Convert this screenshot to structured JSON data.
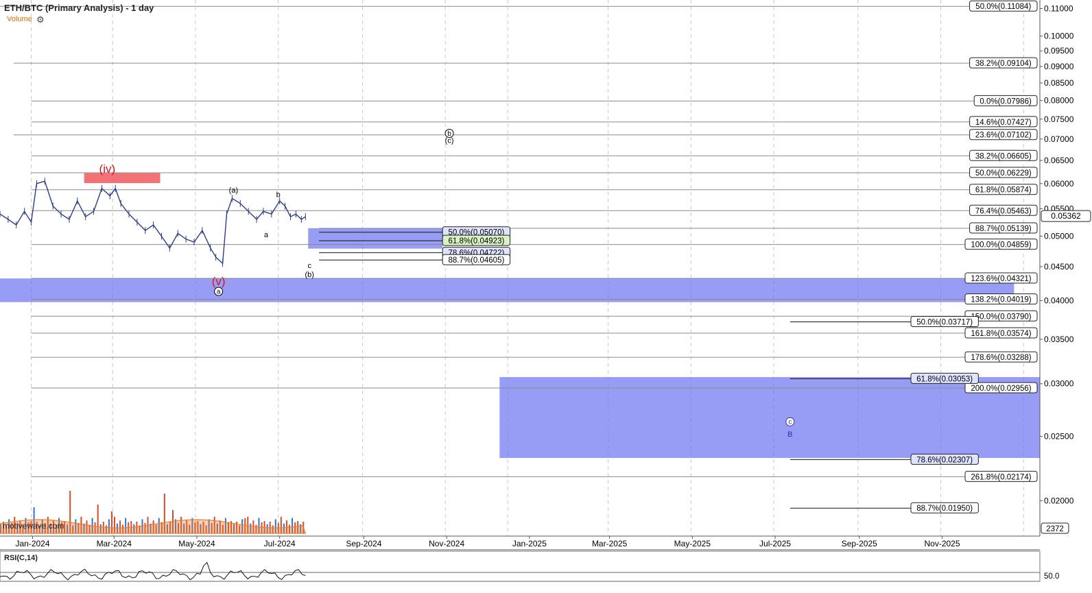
{
  "header": {
    "title": "ETH/BTC (Primary Analysis) - 1 day",
    "volume_label": "Volume",
    "settings_icon": "gear-icon"
  },
  "watermark": "motivewave.com",
  "rsi": {
    "label": "RSI(C,14)",
    "level_label": "50.0"
  },
  "colors": {
    "zone_blue": "#6b73f0",
    "zone_red": "#f0595d",
    "wave_red": "#d8141b",
    "volume_orange": "#f07c2c"
  },
  "chart_data": {
    "type": "line",
    "price_axis": {
      "scale": "log",
      "ylim": [
        0.0177,
        0.1133
      ],
      "ticks": [
        0.11,
        0.1,
        0.095,
        0.09,
        0.085,
        0.08,
        0.075,
        0.07,
        0.065,
        0.06,
        0.055,
        0.05,
        0.045,
        0.04,
        0.035,
        0.03,
        0.025,
        0.02
      ],
      "tick_labels": [
        "0.11000",
        "0.10000",
        "0.09500",
        "0.09000",
        "0.08500",
        "0.08000",
        "0.07500",
        "0.07000",
        "0.06500",
        "0.06000",
        "0.05500",
        "0.05000",
        "0.04500",
        "0.04000",
        "0.03500",
        "0.03000",
        "0.02500",
        "0.02000"
      ],
      "current_price_label": "0.05362",
      "current_price": 0.05362,
      "volume_label": "2372"
    },
    "time_axis": {
      "labels": [
        "Jan-2024",
        "Mar-2024",
        "May-2024",
        "Jul-2024",
        "Sep-2024",
        "Nov-2024",
        "Jan-2025",
        "Mar-2025",
        "May-2025",
        "Jul-2025",
        "Sep-2025",
        "Nov-2025"
      ],
      "label_dates": [
        "2024-01-01",
        "2024-03-01",
        "2024-05-01",
        "2024-07-01",
        "2024-09-01",
        "2024-11-01",
        "2025-01-01",
        "2025-03-01",
        "2025-05-01",
        "2025-07-01",
        "2025-09-01",
        "2025-11-01"
      ],
      "grid_dates": [
        "2023-12-31",
        "2024-02-29",
        "2024-04-30",
        "2024-06-30",
        "2024-08-31",
        "2024-10-31",
        "2024-12-16",
        "2025-02-28",
        "2025-04-30",
        "2025-06-30",
        "2025-08-31",
        "2025-10-31",
        "2025-12-31"
      ],
      "xlim": [
        "2023-12-08",
        "2026-01-12"
      ]
    },
    "price_series": {
      "x": [
        "2023-12-08",
        "2023-12-14",
        "2023-12-20",
        "2023-12-26",
        "2023-12-31",
        "2024-01-04",
        "2024-01-10",
        "2024-01-16",
        "2024-01-22",
        "2024-01-28",
        "2024-02-03",
        "2024-02-09",
        "2024-02-15",
        "2024-02-21",
        "2024-02-27",
        "2024-03-02",
        "2024-03-06",
        "2024-03-12",
        "2024-03-18",
        "2024-03-24",
        "2024-03-30",
        "2024-04-05",
        "2024-04-11",
        "2024-04-17",
        "2024-04-23",
        "2024-04-29",
        "2024-05-05",
        "2024-05-11",
        "2024-05-15",
        "2024-05-20",
        "2024-05-23",
        "2024-05-27",
        "2024-06-02",
        "2024-06-08",
        "2024-06-14",
        "2024-06-19",
        "2024-06-25",
        "2024-07-01",
        "2024-07-05",
        "2024-07-09",
        "2024-07-13",
        "2024-07-17",
        "2024-07-20"
      ],
      "y": [
        0.054,
        0.053,
        0.052,
        0.0545,
        0.0525,
        0.06,
        0.0605,
        0.0555,
        0.054,
        0.053,
        0.0565,
        0.0535,
        0.0545,
        0.059,
        0.0575,
        0.059,
        0.056,
        0.054,
        0.0525,
        0.051,
        0.052,
        0.05,
        0.048,
        0.0505,
        0.0495,
        0.049,
        0.051,
        0.048,
        0.0465,
        0.0455,
        0.054,
        0.057,
        0.056,
        0.0545,
        0.053,
        0.0545,
        0.054,
        0.0565,
        0.0555,
        0.0535,
        0.054,
        0.053,
        0.0535
      ]
    },
    "fib_levels_right": [
      {
        "label": "50.0%(0.11084)",
        "value": 0.11084,
        "start": "2023-12-01",
        "line_color": "#8a8a8a"
      },
      {
        "label": "38.2%(0.09104)",
        "value": 0.09104,
        "start": "2023-12-18",
        "line_color": "#8a8a8a"
      },
      {
        "label": "0.0%(0.07986)",
        "value": 0.07986,
        "start": "2023-12-31",
        "line_color": "#8a8a8a"
      },
      {
        "label": "14.6%(0.07427)",
        "value": 0.07427,
        "start": "2023-12-31",
        "line_color": "#8a8a8a"
      },
      {
        "label": "23.6%(0.07102)",
        "value": 0.07102,
        "start": "2023-12-18",
        "line_color": "#8a8a8a"
      },
      {
        "label": "38.2%(0.06605)",
        "value": 0.06605,
        "start": "2023-12-31",
        "line_color": "#8a8a8a"
      },
      {
        "label": "50.0%(0.06229)",
        "value": 0.06229,
        "start": "2023-12-31",
        "line_color": "#8a8a8a"
      },
      {
        "label": "61.8%(0.05874)",
        "value": 0.05874,
        "start": "2023-12-31",
        "line_color": "#8a8a8a"
      },
      {
        "label": "76.4%(0.05463)",
        "value": 0.05463,
        "start": "2023-12-31",
        "line_color": "#8a8a8a"
      },
      {
        "label": "88.7%(0.05139)",
        "value": 0.05139,
        "start": "2024-07-30",
        "line_color": "#8a8a8a"
      },
      {
        "label": "100.0%(0.04859)",
        "value": 0.04859,
        "start": "2023-12-31",
        "line_color": "#8a8a8a"
      },
      {
        "label": "123.6%(0.04321)",
        "value": 0.04321,
        "start": "2023-12-31",
        "line_color": "#8a8a8a"
      },
      {
        "label": "138.2%(0.04019)",
        "value": 0.04019,
        "start": "2023-12-31",
        "line_color": "#8a8a8a"
      },
      {
        "label": "150.0%(0.03790)",
        "value": 0.0379,
        "start": "2023-12-31",
        "line_color": "#8a8a8a"
      },
      {
        "label": "161.8%(0.03574)",
        "value": 0.03574,
        "start": "2023-12-31",
        "line_color": "#8a8a8a"
      },
      {
        "label": "178.6%(0.03288)",
        "value": 0.03288,
        "start": "2023-12-31",
        "line_color": "#8a8a8a"
      },
      {
        "label": "200.0%(0.02956)",
        "value": 0.02956,
        "start": "2023-12-31",
        "line_color": "#8a8a8a"
      },
      {
        "label": "261.8%(0.02174)",
        "value": 0.02174,
        "start": "2023-12-31",
        "line_color": "#8a8a8a"
      }
    ],
    "fib_levels_mid": [
      {
        "label": "50.0%(0.05070)",
        "value": 0.0507,
        "start": "2024-07-30",
        "end": "2024-10-29",
        "box_fill": "#dfe3ff"
      },
      {
        "label": "61.8%(0.04923)",
        "value": 0.04923,
        "start": "2024-07-30",
        "end": "2024-10-29",
        "box_fill": "#d9f2c4"
      },
      {
        "label": "78.6%(0.04722)",
        "value": 0.04722,
        "start": "2024-07-30",
        "end": "2024-10-29",
        "box_fill": "#dfe3ff"
      },
      {
        "label": "88.7%(0.04605)",
        "value": 0.04605,
        "start": "2024-07-30",
        "end": "2024-10-29",
        "box_fill": "#ffffff"
      },
      {
        "label": "50.0%(0.03717)",
        "value": 0.03717,
        "start": "2025-07-12",
        "end": "2025-10-09",
        "box_fill": "#ffffff"
      },
      {
        "label": "61.8%(0.03053)",
        "value": 0.03053,
        "start": "2025-07-12",
        "end": "2025-10-09",
        "box_fill": "#dfe3ff"
      },
      {
        "label": "78.6%(0.02307)",
        "value": 0.02307,
        "start": "2025-07-12",
        "end": "2025-10-09",
        "box_fill": "#dfe3ff"
      },
      {
        "label": "88.7%(0.01950)",
        "value": 0.0195,
        "start": "2025-07-12",
        "end": "2025-10-09",
        "box_fill": "#ffffff"
      }
    ],
    "zones": [
      {
        "name": "iv-zone",
        "color": "red",
        "x0": "2024-02-08",
        "x1": "2024-04-04",
        "y0": 0.0622,
        "y1": 0.0601
      },
      {
        "name": "b-target-zone",
        "color": "blue",
        "x0": "2024-07-22",
        "x1": "2024-10-29",
        "y0": 0.0514,
        "y1": 0.0479
      },
      {
        "name": "a-support-zone",
        "color": "blue",
        "x0": "2023-12-08",
        "x1": "2025-12-24",
        "y0": 0.0432,
        "y1": 0.0398
      },
      {
        "name": "c-target-zone",
        "color": "blue",
        "x0": "2024-12-10",
        "x1": "2026-01-12",
        "y0": 0.0307,
        "y1": 0.0232
      }
    ],
    "wave_labels": [
      {
        "text": "(iv)",
        "date": "2024-02-25",
        "price": 0.0632,
        "color": "red",
        "size": 17
      },
      {
        "text": "(v)",
        "date": "2024-05-17",
        "price": 0.0428,
        "color": "red",
        "size": 17
      },
      {
        "text": "a",
        "date": "2024-05-17",
        "price": 0.0413,
        "color": "black",
        "circle": true,
        "size": 10
      },
      {
        "text": "(a)",
        "date": "2024-05-28",
        "price": 0.0587,
        "color": "black",
        "size": 11
      },
      {
        "text": "a",
        "date": "2024-06-21",
        "price": 0.0503,
        "color": "black",
        "size": 11
      },
      {
        "text": "b",
        "date": "2024-06-30",
        "price": 0.0578,
        "color": "black",
        "size": 11
      },
      {
        "text": "c",
        "date": "2024-07-23",
        "price": 0.0452,
        "color": "black",
        "size": 11
      },
      {
        "text": "(b)",
        "date": "2024-07-23",
        "price": 0.0438,
        "color": "black",
        "size": 11
      },
      {
        "text": "b",
        "date": "2024-11-03",
        "price": 0.0714,
        "color": "black",
        "circle": true,
        "size": 10
      },
      {
        "text": "(c)",
        "date": "2024-11-03",
        "price": 0.0697,
        "color": "black",
        "size": 11
      },
      {
        "text": "c",
        "date": "2025-07-12",
        "price": 0.0263,
        "color": "#2b2fb0",
        "circle": true,
        "size": 10
      },
      {
        "text": "B",
        "date": "2025-07-12",
        "price": 0.0252,
        "color": "#2b2fb0",
        "size": 11
      }
    ]
  }
}
